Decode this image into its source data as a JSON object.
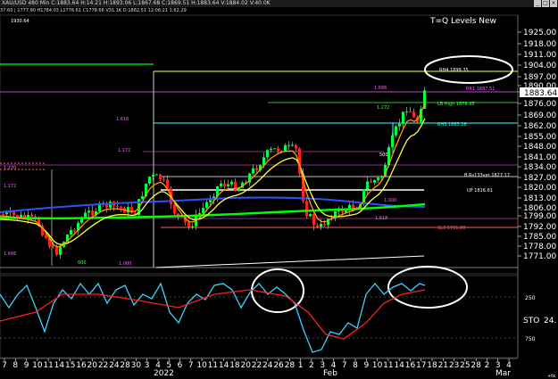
{
  "window": {
    "title": "XAU/USD 480 Min  C:1883.64  H:14.21  H:1893.06  L:1867.68  C:1869.51  H:1883.64  V:1884.02  V:40.0K"
  },
  "ohlc_row": "37:60 | 1777.90  H1784.03  L1776.61  C1778.66  V31.1K  D:1882.51  12:06:21  1:62.29",
  "indicator_title": "T=Q Levels New",
  "top_left_label": "1930.64",
  "oscillator": {
    "name": "STO",
    "value": "24.",
    "levels": [
      "250",
      "750"
    ]
  },
  "price_axis": {
    "ticks": [
      "1925.00",
      "1918.00",
      "1911.00",
      "1904.00",
      "1897.00",
      "1890.00",
      "1876.00",
      "1869.00",
      "1862.00",
      "1855.00",
      "1848.00",
      "1841.00",
      "1834.00",
      "1827.00",
      "1820.00",
      "1813.00",
      "1806.00",
      "1799.00",
      "1792.00",
      "1785.00",
      "1778.00",
      "1771.00"
    ],
    "current": "1883.64"
  },
  "time_axis": {
    "days": [
      "7",
      "8",
      "9",
      "10",
      "11",
      "14",
      "15",
      "16",
      "20",
      "22",
      "24",
      "28",
      "30",
      "3",
      "4",
      "5",
      "6",
      "7",
      "10",
      "11",
      "14",
      "18",
      "20",
      "22",
      "24",
      "26",
      "28",
      "1",
      "2",
      "3",
      "4",
      "7",
      "8",
      "9",
      "10",
      "11",
      "14",
      "16",
      "17",
      "18",
      "21",
      "23",
      "25",
      "28",
      "2",
      "3",
      "4"
    ],
    "months": [
      "2022",
      "Feb",
      "Mar"
    ],
    "edge_label": "+tx"
  },
  "levels": [
    {
      "text": "RH4 1899.35",
      "color": "#ffffff"
    },
    {
      "text": "RR1 1887.51",
      "color": "#ff5fff"
    },
    {
      "text": "LB High 1878.95",
      "color": "#40ff40"
    },
    {
      "text": "RH3 1863.28",
      "color": "#40ffff"
    },
    {
      "text": "B Rs133ver 1827.17",
      "color": "#ffffff"
    },
    {
      "text": "UP 1816.61",
      "color": "#ffffff"
    },
    {
      "text": "SL3 1791.08",
      "color": "#ff5f5f"
    }
  ],
  "fib_labels": [
    "1.686",
    "1.272",
    "1.616",
    "1.272",
    "1.000",
    "1.618",
    "1.270",
    "1.272",
    "1.666",
    "1.000",
    "500",
    "000"
  ],
  "colors": {
    "up_candle": "#00ff40",
    "down_candle": "#ff2020",
    "ma_orange": "#ff9a00",
    "ma_yellow": "#ffff40",
    "ma_blue": "#3050ff",
    "ma_green": "#00ff00",
    "stoch_cyan": "#40d0ff",
    "stoch_red": "#ff2020"
  }
}
